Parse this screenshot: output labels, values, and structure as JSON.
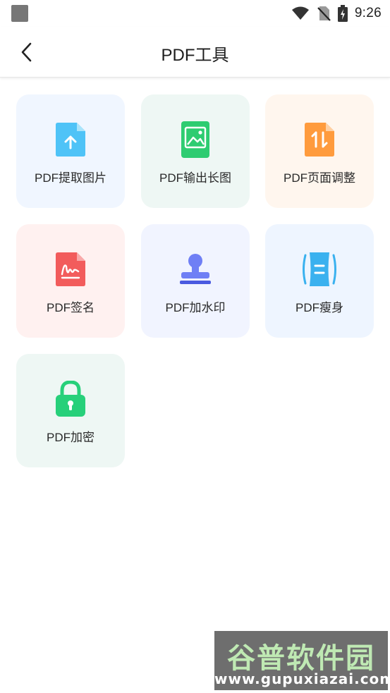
{
  "status_bar": {
    "time": "9:26",
    "icons": [
      "notification-square-icon",
      "wifi-icon",
      "no-sim-icon",
      "battery-charging-icon"
    ]
  },
  "header": {
    "back_icon": "chevron-left-icon",
    "title": "PDF工具"
  },
  "tools": [
    {
      "label": "PDF提取图片",
      "icon": "pdf-extract-image-icon",
      "bg": "#f0f6ff",
      "accent": "#4fc3f7"
    },
    {
      "label": "PDF输出长图",
      "icon": "pdf-long-image-icon",
      "bg": "#eef7f4",
      "accent": "#2ecc71"
    },
    {
      "label": "PDF页面调整",
      "icon": "pdf-page-adjust-icon",
      "bg": "#fff6ee",
      "accent": "#ff9b3d"
    },
    {
      "label": "PDF签名",
      "icon": "pdf-signature-icon",
      "bg": "#fff1f0",
      "accent": "#f25c5c"
    },
    {
      "label": "PDF加水印",
      "icon": "pdf-watermark-stamp-icon",
      "bg": "#f1f4ff",
      "accent": "#6f7ff5"
    },
    {
      "label": "PDF瘦身",
      "icon": "pdf-compress-icon",
      "bg": "#eef5ff",
      "accent": "#3ab1ef"
    },
    {
      "label": "PDF加密",
      "icon": "pdf-encrypt-lock-icon",
      "bg": "#eef7f4",
      "accent": "#27d07a"
    }
  ],
  "watermark": {
    "text": "谷普软件园",
    "url": "www.gupuxiazai.com"
  }
}
